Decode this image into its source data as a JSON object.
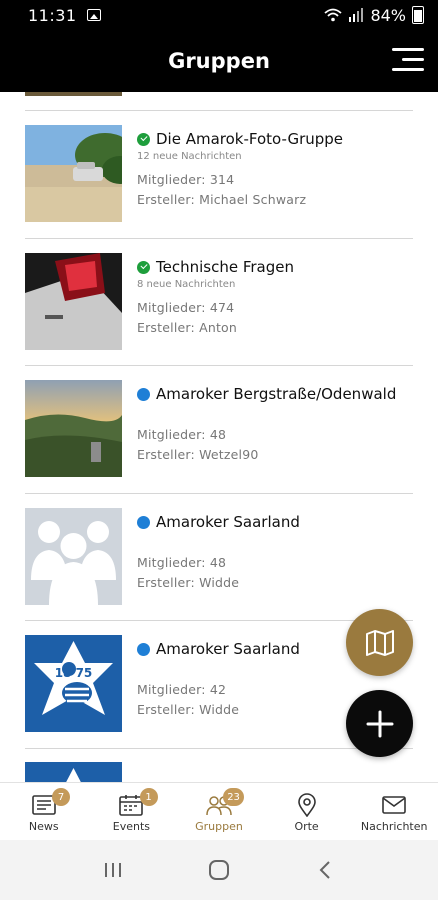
{
  "status_bar": {
    "time": "11:31",
    "battery": "84%"
  },
  "header": {
    "title": "Gruppen"
  },
  "groups": [
    {
      "name": "Die Amarok-Foto-Gruppe",
      "status": "green",
      "new_messages": "12 neue Nachrichten",
      "members": "Mitglieder: 314",
      "creator": "Ersteller: Michael Schwarz"
    },
    {
      "name": "Technische Fragen",
      "status": "green",
      "new_messages": "8 neue Nachrichten",
      "members": "Mitglieder: 474",
      "creator": "Ersteller: Anton"
    },
    {
      "name": "Amaroker Bergstraße/Odenwald",
      "status": "blue",
      "members": "Mitglieder: 48",
      "creator": "Ersteller: Wetzel90"
    },
    {
      "name": "Amaroker Saarland",
      "status": "blue",
      "members": "Mitglieder: 48",
      "creator": "Ersteller: Widde"
    },
    {
      "name": "Amaroker Saarland",
      "status": "blue",
      "members": "Mitglieder: 42",
      "creator": "Ersteller: Widde"
    }
  ],
  "badge_text": "18 75",
  "tabs": [
    {
      "label": "News",
      "badge": "7",
      "icon": "news-icon"
    },
    {
      "label": "Events",
      "badge": "1",
      "icon": "calendar-icon"
    },
    {
      "label": "Gruppen",
      "badge": "23",
      "icon": "groups-icon",
      "active": true
    },
    {
      "label": "Orte",
      "icon": "location-pin-icon"
    },
    {
      "label": "Nachrichten",
      "icon": "envelope-icon"
    }
  ],
  "colors": {
    "accent": "#9a7a3e",
    "badge": "#c49a5a",
    "green": "#1e9e3c",
    "blue": "#1f7fd6",
    "header": "#000000"
  }
}
